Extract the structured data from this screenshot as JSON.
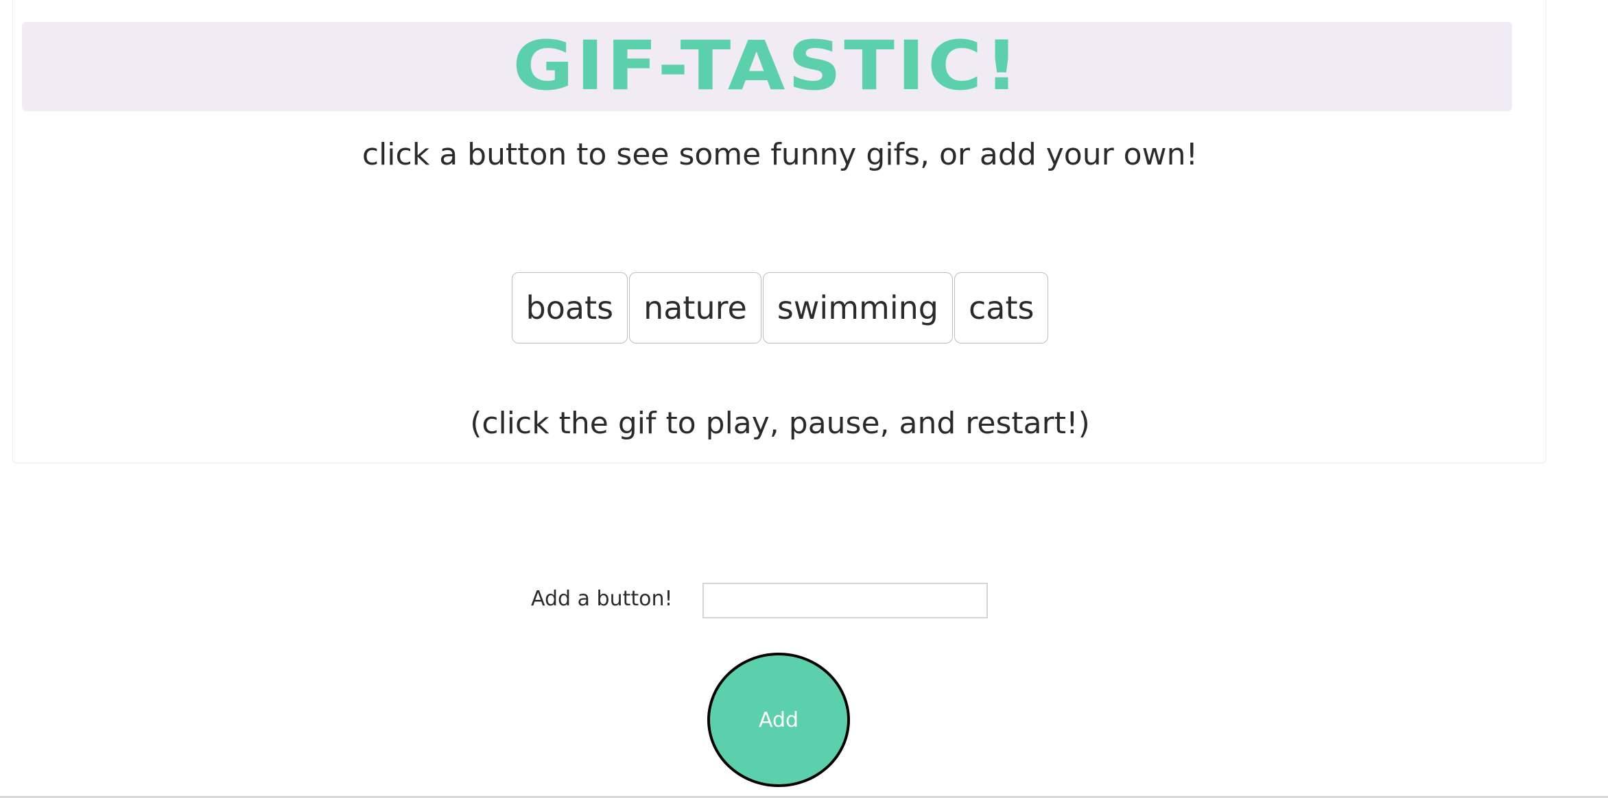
{
  "header": {
    "title": "GIF-TASTIC!",
    "subtitle": "click a button to see some funny gifs, or add your own!"
  },
  "topics": [
    {
      "label": "boats"
    },
    {
      "label": "nature"
    },
    {
      "label": "swimming"
    },
    {
      "label": "cats"
    }
  ],
  "hint": "(click the gif to play, pause, and restart!)",
  "form": {
    "label": "Add a button!",
    "input_value": "",
    "submit_label": "Add"
  },
  "colors": {
    "accent": "#5ccfab",
    "jumbotron_bg": "#f1ebf5"
  }
}
